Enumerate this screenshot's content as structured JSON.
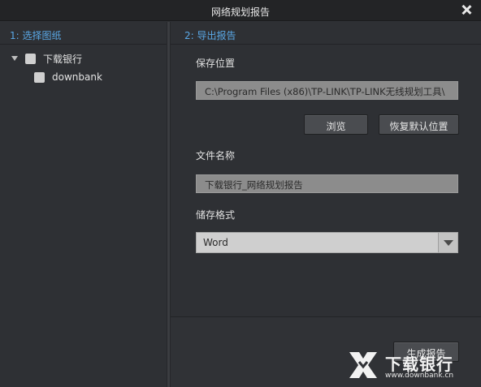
{
  "window": {
    "title": "网络规划报告"
  },
  "left": {
    "header": "1: 选择图纸",
    "tree": {
      "root_label": "下载银行",
      "child_label": "downbank"
    }
  },
  "right": {
    "header": "2: 导出报告",
    "save_location": {
      "label": "保存位置",
      "value": "C:\\Program Files (x86)\\TP-LINK\\TP-LINK无线规划工具\\"
    },
    "browse_button": "浏览",
    "restore_default_button": "恢复默认位置",
    "file_name": {
      "label": "文件名称",
      "value": "下载银行_网络规划报告"
    },
    "storage_format": {
      "label": "储存格式",
      "selected": "Word"
    },
    "generate_button": "生成报告"
  },
  "watermark": {
    "text": "下载银行",
    "url": "www.downbank.cn"
  }
}
